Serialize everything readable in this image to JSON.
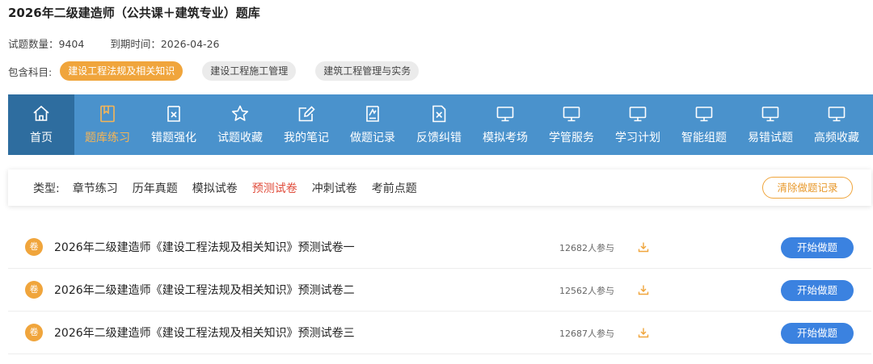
{
  "header": {
    "title": "2026年二级建造师（公共课＋建筑专业）题库",
    "question_count_label": "试题数量：",
    "question_count": "9404",
    "expiry_label": "到期时间：",
    "expiry_date": "2026-04-26"
  },
  "subjects": {
    "label": "包含科目:",
    "items": [
      {
        "label": "建设工程法规及相关知识",
        "active": true
      },
      {
        "label": "建设工程施工管理",
        "active": false
      },
      {
        "label": "建筑工程管理与实务",
        "active": false
      }
    ]
  },
  "nav": {
    "items": [
      {
        "label": "首页",
        "icon": "home-icon"
      },
      {
        "label": "题库练习",
        "icon": "book-icon"
      },
      {
        "label": "错题强化",
        "icon": "wrong-doc-icon"
      },
      {
        "label": "试题收藏",
        "icon": "star-icon"
      },
      {
        "label": "我的笔记",
        "icon": "note-edit-icon"
      },
      {
        "label": "做题记录",
        "icon": "record-icon"
      },
      {
        "label": "反馈纠错",
        "icon": "feedback-icon"
      },
      {
        "label": "模拟考场",
        "icon": "monitor-icon"
      },
      {
        "label": "学管服务",
        "icon": "monitor-icon"
      },
      {
        "label": "学习计划",
        "icon": "monitor-icon"
      },
      {
        "label": "智能组题",
        "icon": "monitor-icon"
      },
      {
        "label": "易错试题",
        "icon": "monitor-icon"
      },
      {
        "label": "高频收藏",
        "icon": "monitor-icon"
      }
    ],
    "active_index": 1,
    "highlight_index": 0,
    "bar_color": "#4a92cc",
    "highlight_color": "#2e6d9f",
    "active_color": "#f6b556"
  },
  "filter": {
    "label": "类型:",
    "types": [
      "章节练习",
      "历年真题",
      "模拟试卷",
      "预测试卷",
      "冲刺试卷",
      "考前点题"
    ],
    "active_index": 3,
    "clear_button": "清除做题记录"
  },
  "papers": [
    {
      "badge": "卷",
      "title": "2026年二级建造师《建设工程法规及相关知识》预测试卷一",
      "participants": "12682人参与",
      "action": "开始做题"
    },
    {
      "badge": "卷",
      "title": "2026年二级建造师《建设工程法规及相关知识》预测试卷二",
      "participants": "12562人参与",
      "action": "开始做题"
    },
    {
      "badge": "卷",
      "title": "2026年二级建造师《建设工程法规及相关知识》预测试卷三",
      "participants": "12687人参与",
      "action": "开始做题"
    }
  ],
  "colors": {
    "accent_orange": "#f0a53c",
    "active_red": "#e04b3a",
    "primary_blue": "#3b82e0"
  }
}
